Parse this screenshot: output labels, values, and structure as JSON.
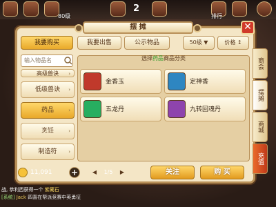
{
  "hud": {
    "number": "2",
    "labels": [
      "排行",
      "80级"
    ]
  },
  "panel": {
    "title": "摆 摊",
    "close_icon": "close-icon"
  },
  "tabs": [
    {
      "label": "我要购买",
      "active": true
    },
    {
      "label": "我要出售",
      "active": false
    },
    {
      "label": "公示物品",
      "active": false
    }
  ],
  "level_select": "50级 ▼",
  "price_sort": "价格 ↕",
  "search": {
    "placeholder": "输入物品名"
  },
  "categories": [
    {
      "label": "高级兽诀"
    },
    {
      "label": "低级兽诀"
    },
    {
      "label": "药品",
      "active": true
    },
    {
      "label": "烹饪"
    },
    {
      "label": "制造符"
    }
  ],
  "content_header": {
    "prefix": "选择",
    "highlight": "药品",
    "suffix": "商品分类"
  },
  "items": [
    {
      "name": "金香玉",
      "icon": "gift-bag-icon"
    },
    {
      "name": "定神香",
      "icon": "incense-bowl-icon"
    },
    {
      "name": "五龙丹",
      "icon": "pills-icon"
    },
    {
      "name": "九转回魂丹",
      "icon": "potion-bottle-icon"
    }
  ],
  "bottom": {
    "coins": "11,091",
    "plus": "+",
    "page": "1/5",
    "prev": "◀",
    "next": "▶",
    "follow_button": "关注",
    "buy_button": "购 买"
  },
  "side_tabs": [
    {
      "label": "商会"
    },
    {
      "label": "摆摊",
      "active": true
    },
    {
      "label": "商城"
    },
    {
      "label": "充值",
      "red": true
    }
  ],
  "chat": {
    "line1_prefix": "战",
    "line1_text": "恭利西获得一个",
    "line1_item": "紫藏石",
    "line2_sys": "[系统]",
    "line2_name": "Jack",
    "line2_text": "四喜在帮派竞赛中英勇征"
  },
  "colors": {
    "accent_gold": "#e9a92a",
    "panel_bg": "#f4e6c6",
    "highlight_green": "#2f9a2a",
    "close_red": "#d03a2a"
  }
}
